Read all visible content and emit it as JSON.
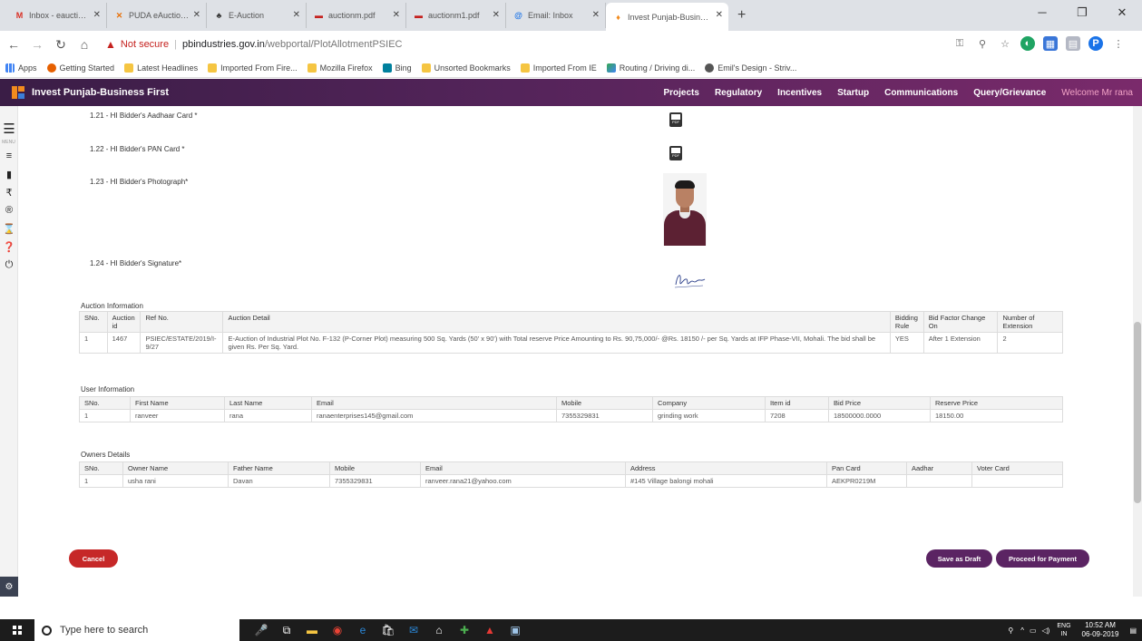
{
  "browser": {
    "tabs": [
      {
        "title": "Inbox - eauctions.psiec@",
        "favicon": "gmail-icon",
        "active": false
      },
      {
        "title": "PUDA eAuctions Portal |",
        "favicon": "puda-icon",
        "active": false
      },
      {
        "title": "E-Auction",
        "favicon": "auction-icon",
        "active": false
      },
      {
        "title": "auctionm.pdf",
        "favicon": "pdf-icon",
        "active": false
      },
      {
        "title": "auctionm1.pdf",
        "favicon": "pdf-icon",
        "active": false
      },
      {
        "title": "Email: Inbox",
        "favicon": "email-icon",
        "active": false
      },
      {
        "title": "Invest Punjab-Business F",
        "favicon": "invest-punjab-icon",
        "active": true
      }
    ],
    "address": {
      "security": "Not secure",
      "host": "pbindustries.gov.in",
      "path": "/webportal/PlotAllotmentPSIEC"
    },
    "bookmarks": [
      {
        "label": "Apps",
        "icon": "apps-icon"
      },
      {
        "label": "Getting Started",
        "icon": "firefox-icon"
      },
      {
        "label": "Latest Headlines",
        "icon": "folder-icon"
      },
      {
        "label": "Imported From Fire...",
        "icon": "folder-icon"
      },
      {
        "label": "Mozilla Firefox",
        "icon": "folder-icon"
      },
      {
        "label": "Bing",
        "icon": "bing-icon"
      },
      {
        "label": "Unsorted Bookmarks",
        "icon": "folder-icon"
      },
      {
        "label": "Imported From IE",
        "icon": "folder-icon"
      },
      {
        "label": "Routing / Driving di...",
        "icon": "map-icon"
      },
      {
        "label": "Emil's Design - Striv...",
        "icon": "globe-icon"
      }
    ]
  },
  "site": {
    "brand": "Invest Punjab-Business First",
    "nav": [
      "Projects",
      "Regulatory",
      "Incentives",
      "Startup",
      "Communications",
      "Query/Grievance"
    ],
    "welcome": "Welcome Mr rana",
    "sidebar_menu_label": "MENU"
  },
  "documents": [
    {
      "label": "1.21 - HI Bidder's Aadhaar Card *",
      "kind": "pdf"
    },
    {
      "label": "1.22 - HI Bidder's PAN Card *",
      "kind": "pdf"
    },
    {
      "label": "1.23 - HI Bidder's Photograph*",
      "kind": "photo"
    },
    {
      "label": "1.24 - HI Bidder's Signature*",
      "kind": "signature"
    }
  ],
  "auction": {
    "title": "Auction Information",
    "headers": [
      "SNo.",
      "Auction id",
      "Ref No.",
      "Auction Detail",
      "Bidding Rule",
      "Bid Factor Change On",
      "Number of Extension"
    ],
    "rows": [
      [
        "1",
        "1467",
        "PSIEC/ESTATE/2019/I-9/27",
        "E-Auction of Industrial Plot No. F-132 (P-Corner Plot) measuring 500 Sq. Yards (50' x 90') with Total reserve Price Amounting to Rs. 90,75,000/- @Rs. 18150 /- per Sq. Yards at IFP Phase-VII, Mohali. The bid shall be given Rs. Per Sq. Yard.",
        "YES",
        "After 1 Extension",
        "2"
      ]
    ]
  },
  "user": {
    "title": "User Information",
    "headers": [
      "SNo.",
      "First Name",
      "Last Name",
      "Email",
      "Mobile",
      "Company",
      "Item id",
      "Bid Price",
      "Reserve Price"
    ],
    "rows": [
      [
        "1",
        "ranveer",
        "rana",
        "ranaenterprises145@gmail.com",
        "7355329831",
        "grinding work",
        "7208",
        "18500000.0000",
        "18150.00"
      ]
    ]
  },
  "owners": {
    "title": "Owners Details",
    "headers": [
      "SNo.",
      "Owner Name",
      "Father Name",
      "Mobile",
      "Email",
      "Address",
      "Pan Card",
      "Aadhar",
      "Voter Card"
    ],
    "rows": [
      [
        "1",
        "usha rani",
        "Davan",
        "7355329831",
        "ranveer.rana21@yahoo.com",
        "#145 Village balongi mohali",
        "AEKPR0219M",
        "",
        ""
      ]
    ]
  },
  "actions": {
    "cancel": "Cancel",
    "save_draft": "Save as Draft",
    "proceed": "Proceed for Payment"
  },
  "taskbar": {
    "search_placeholder": "Type here to search",
    "time": "10:52 AM",
    "date": "06-09-2019",
    "lang_top": "ENG",
    "lang_bottom": "IN"
  }
}
